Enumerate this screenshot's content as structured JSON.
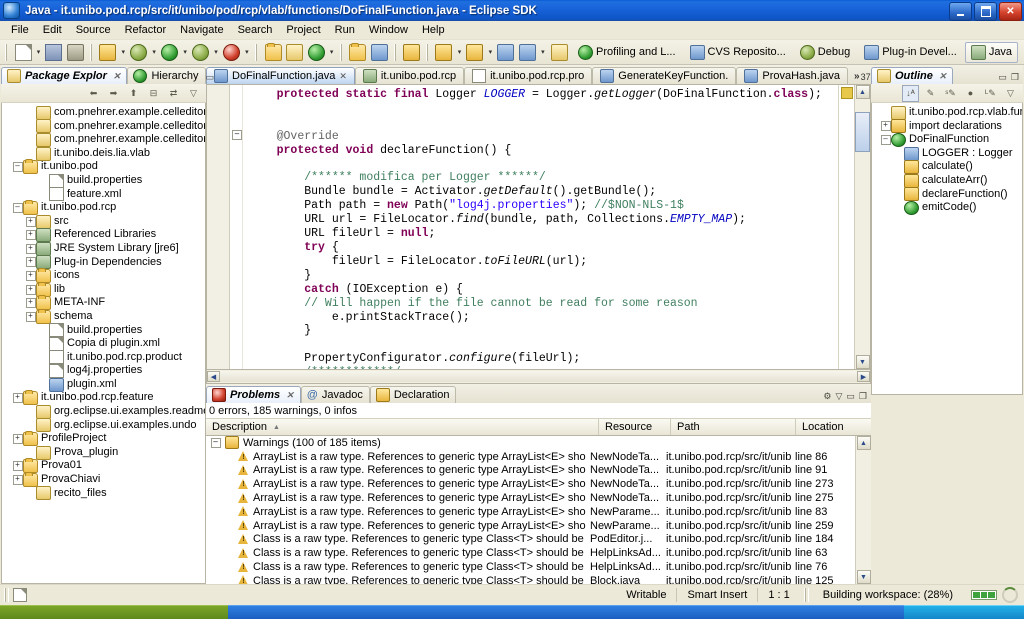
{
  "window": {
    "title": "Java - it.unibo.pod.rcp/src/it/unibo/pod/rcp/vlab/functions/DoFinalFunction.java - Eclipse SDK",
    "minimize_label": "Minimize",
    "maximize_label": "Maximize",
    "close_label": "Close"
  },
  "menu": [
    "File",
    "Edit",
    "Source",
    "Refactor",
    "Navigate",
    "Search",
    "Project",
    "Run",
    "Window",
    "Help"
  ],
  "perspectives": [
    {
      "label": "Profiling and L...",
      "icon": "profiling-icon",
      "active": false
    },
    {
      "label": "CVS Reposito...",
      "icon": "cvs-icon",
      "active": false
    },
    {
      "label": "Debug",
      "icon": "debug-icon",
      "active": false
    },
    {
      "label": "Plug-in Devel...",
      "icon": "plugin-icon",
      "active": false
    },
    {
      "label": "Java",
      "icon": "java-icon",
      "active": true
    }
  ],
  "package_explorer": {
    "tabs": [
      {
        "label": "Package Explor",
        "icon": "package-explorer-icon",
        "selected": true,
        "closeable": true
      },
      {
        "label": "Hierarchy",
        "icon": "hierarchy-icon",
        "selected": false,
        "closeable": false
      }
    ],
    "toolbar": [
      "back-icon",
      "forward-icon",
      "up-icon",
      "collapse-all-icon",
      "link-editor-icon",
      "view-menu-icon"
    ],
    "tree": [
      {
        "depth": 1,
        "toggle": "none",
        "icon": "package-icon",
        "label": "com.pnehrer.example.celleditor"
      },
      {
        "depth": 1,
        "toggle": "none",
        "icon": "package-icon",
        "label": "com.pnehrer.example.celleditor.edit"
      },
      {
        "depth": 1,
        "toggle": "none",
        "icon": "package-icon",
        "label": "com.pnehrer.example.celleditor.ui"
      },
      {
        "depth": 1,
        "toggle": "none",
        "icon": "package-icon",
        "label": "it.unibo.deis.lia.vlab"
      },
      {
        "depth": 0,
        "toggle": "minus",
        "icon": "feature-project-icon",
        "label": "it.unibo.pod"
      },
      {
        "depth": 2,
        "toggle": "none",
        "icon": "properties-icon",
        "label": "build.properties"
      },
      {
        "depth": 2,
        "toggle": "none",
        "icon": "xml-icon",
        "label": "feature.xml"
      },
      {
        "depth": 0,
        "toggle": "minus",
        "icon": "plugin-project-icon",
        "label": "it.unibo.pod.rcp"
      },
      {
        "depth": 1,
        "toggle": "plus",
        "icon": "source-folder-icon",
        "label": "src"
      },
      {
        "depth": 1,
        "toggle": "plus",
        "icon": "library-icon",
        "label": "Referenced Libraries"
      },
      {
        "depth": 1,
        "toggle": "plus",
        "icon": "library-icon",
        "label": "JRE System Library [jre6]"
      },
      {
        "depth": 1,
        "toggle": "plus",
        "icon": "library-icon",
        "label": "Plug-in Dependencies"
      },
      {
        "depth": 1,
        "toggle": "plus",
        "icon": "folder-icon",
        "label": "icons"
      },
      {
        "depth": 1,
        "toggle": "plus",
        "icon": "folder-icon",
        "label": "lib"
      },
      {
        "depth": 1,
        "toggle": "plus",
        "icon": "folder-icon",
        "label": "META-INF"
      },
      {
        "depth": 1,
        "toggle": "plus",
        "icon": "folder-icon",
        "label": "schema"
      },
      {
        "depth": 2,
        "toggle": "none",
        "icon": "properties-icon",
        "label": "build.properties"
      },
      {
        "depth": 2,
        "toggle": "none",
        "icon": "file-icon",
        "label": "Copia di plugin.xml"
      },
      {
        "depth": 2,
        "toggle": "none",
        "icon": "product-icon",
        "label": "it.unibo.pod.rcp.product"
      },
      {
        "depth": 2,
        "toggle": "none",
        "icon": "file-icon",
        "label": "log4j.properties"
      },
      {
        "depth": 2,
        "toggle": "none",
        "icon": "plugin-xml-icon",
        "label": "plugin.xml"
      },
      {
        "depth": 0,
        "toggle": "plus",
        "icon": "feature-project-icon",
        "label": "it.unibo.pod.rcp.feature"
      },
      {
        "depth": 1,
        "toggle": "none",
        "icon": "closed-project-icon",
        "label": "org.eclipse.ui.examples.readmetool"
      },
      {
        "depth": 1,
        "toggle": "none",
        "icon": "closed-project-icon",
        "label": "org.eclipse.ui.examples.undo"
      },
      {
        "depth": 0,
        "toggle": "plus",
        "icon": "feature-project-icon",
        "label": "ProfileProject"
      },
      {
        "depth": 1,
        "toggle": "none",
        "icon": "closed-project-icon",
        "label": "Prova_plugin"
      },
      {
        "depth": 0,
        "toggle": "plus",
        "icon": "feature-project-icon",
        "label": "Prova01"
      },
      {
        "depth": 0,
        "toggle": "plus",
        "icon": "plugin-project-icon",
        "label": "ProvaChiavi"
      },
      {
        "depth": 1,
        "toggle": "none",
        "icon": "closed-project-icon",
        "label": "recito_files"
      }
    ]
  },
  "editor": {
    "tabs": [
      {
        "label": "DoFinalFunction.java",
        "icon": "java-file-icon",
        "selected": true,
        "closeable": true
      },
      {
        "label": "it.unibo.pod.rcp",
        "icon": "plugin-icon",
        "selected": false,
        "closeable": false
      },
      {
        "label": "it.unibo.pod.rcp.pro",
        "icon": "product-icon",
        "selected": false,
        "closeable": false
      },
      {
        "label": "GenerateKeyFunction.",
        "icon": "java-file-icon",
        "selected": false,
        "closeable": false
      },
      {
        "label": "ProvaHash.java",
        "icon": "java-file-icon",
        "selected": false,
        "closeable": false
      }
    ],
    "overflow_count": "37",
    "overflow_symbol": "»",
    "code_lines": [
      "    <span class=\"kw\">protected static final</span> Logger <span class=\"fld\">LOGGER</span> = Logger.<span class=\"mth\">getLogger</span>(DoFinalFunction.<span class=\"kw\">class</span>);",
      "",
      "",
      "    <span class=\"tsk\">@Override</span>",
      "    <span class=\"kw\">protected void</span> declareFunction() {",
      "",
      "        <span class=\"cm\">/****** modifica per Logger ******/</span>",
      "        Bundle bundle = Activator.<span class=\"mth\">getDefault</span>().getBundle();",
      "        Path path = <span class=\"kw\">new</span> Path(<span class=\"st\">\"log4j.properties\"</span>); <span class=\"cm\">//$NON-NLS-1$</span>",
      "        URL url = FileLocator.<span class=\"mth\">find</span>(bundle, path, Collections.<span class=\"fld\">EMPTY_MAP</span>);",
      "        URL fileUrl = <span class=\"kw\">null</span>;",
      "        <span class=\"kw\">try</span> {",
      "            fileUrl = FileLocator.<span class=\"mth\">toFileURL</span>(url);",
      "        }",
      "        <span class=\"kw\">catch</span> (IOException e) {",
      "        <span class=\"cm\">// Will happen if the file cannot be read for some reason</span>",
      "            e.printStackTrace();",
      "        }",
      "",
      "        PropertyConfigurator.<span class=\"mth\">configure</span>(fileUrl);",
      "        <span class=\"cm\">/************/</span>"
    ]
  },
  "outline": {
    "tab_label": "Outline",
    "toolbar": [
      "sort-icon",
      "hide-fields-icon",
      "hide-static-icon",
      "hide-nonpublic-icon",
      "hide-local-icon",
      "view-menu-icon"
    ],
    "items": [
      {
        "depth": 0,
        "toggle": "none",
        "icon": "package-decl-icon",
        "label": "it.unibo.pod.rcp.vlab.funct"
      },
      {
        "depth": 0,
        "toggle": "plus",
        "icon": "import-icon",
        "label": "import declarations"
      },
      {
        "depth": 0,
        "toggle": "minus",
        "icon": "class-icon",
        "label": "DoFinalFunction"
      },
      {
        "depth": 1,
        "toggle": "none",
        "icon": "field-static-final-icon",
        "label": "LOGGER : Logger"
      },
      {
        "depth": 1,
        "toggle": "none",
        "icon": "method-protected-icon",
        "label": "calculate()"
      },
      {
        "depth": 1,
        "toggle": "none",
        "icon": "method-protected-icon",
        "label": "calculateArr()"
      },
      {
        "depth": 1,
        "toggle": "none",
        "icon": "method-protected-icon",
        "label": "declareFunction()"
      },
      {
        "depth": 1,
        "toggle": "none",
        "icon": "method-public-icon",
        "label": "emitCode()"
      }
    ]
  },
  "problems": {
    "tabs": [
      {
        "label": "Problems",
        "icon": "problems-icon",
        "selected": true,
        "closeable": true
      },
      {
        "label": "Javadoc",
        "icon": "javadoc-icon",
        "selected": false,
        "closeable": false
      },
      {
        "label": "Declaration",
        "icon": "declaration-icon",
        "selected": false,
        "closeable": false
      }
    ],
    "summary": "0 errors, 185 warnings, 0 infos",
    "columns": [
      "Description",
      "Resource",
      "Path",
      "Location"
    ],
    "sort_indicator": "▲",
    "group_row": {
      "label": "Warnings (100 of 185 items)",
      "toggle": "minus",
      "icon": "warnings-group-icon"
    },
    "rows": [
      {
        "desc": "ArrayList is a raw type. References to generic type ArrayList<E> should be parameterized",
        "resource": "NewNodeTa...",
        "path": "it.unibo.pod.rcp/src/it/unib...",
        "location": "line 86"
      },
      {
        "desc": "ArrayList is a raw type. References to generic type ArrayList<E> should be parameterized",
        "resource": "NewNodeTa...",
        "path": "it.unibo.pod.rcp/src/it/unib...",
        "location": "line 91"
      },
      {
        "desc": "ArrayList is a raw type. References to generic type ArrayList<E> should be parameterized",
        "resource": "NewNodeTa...",
        "path": "it.unibo.pod.rcp/src/it/unib...",
        "location": "line 273"
      },
      {
        "desc": "ArrayList is a raw type. References to generic type ArrayList<E> should be parameterized",
        "resource": "NewNodeTa...",
        "path": "it.unibo.pod.rcp/src/it/unib...",
        "location": "line 275"
      },
      {
        "desc": "ArrayList is a raw type. References to generic type ArrayList<E> should be parameterized",
        "resource": "NewParame...",
        "path": "it.unibo.pod.rcp/src/it/unib...",
        "location": "line 83"
      },
      {
        "desc": "ArrayList is a raw type. References to generic type ArrayList<E> should be parameterized",
        "resource": "NewParame...",
        "path": "it.unibo.pod.rcp/src/it/unib...",
        "location": "line 259"
      },
      {
        "desc": "Class is a raw type. References to generic type Class<T> should be parameterized",
        "resource": "PodEditor.j...",
        "path": "it.unibo.pod.rcp/src/it/unib...",
        "location": "line 184"
      },
      {
        "desc": "Class is a raw type. References to generic type Class<T> should be parameterized",
        "resource": "HelpLinksAd...",
        "path": "it.unibo.pod.rcp/src/it/unib...",
        "location": "line 63"
      },
      {
        "desc": "Class is a raw type. References to generic type Class<T> should be parameterized",
        "resource": "HelpLinksAd...",
        "path": "it.unibo.pod.rcp/src/it/unib...",
        "location": "line 76"
      },
      {
        "desc": "Class is a raw type. References to generic type Class<T> should be parameterized",
        "resource": "Block.java",
        "path": "it.unibo.pod.rcp/src/it/unib...",
        "location": "line 125"
      }
    ]
  },
  "status": {
    "writable": "Writable",
    "insert_mode": "Smart Insert",
    "position": "1 : 1",
    "job": "Building workspace: (28%)",
    "progress_percent": 28
  }
}
